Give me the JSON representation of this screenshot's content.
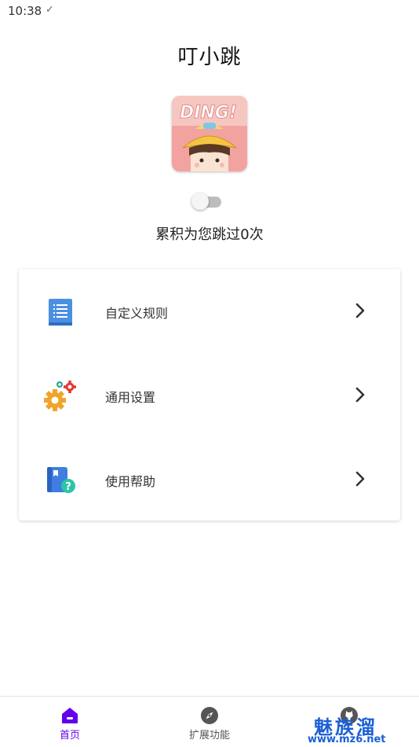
{
  "status_bar": {
    "time": "10:38",
    "check": "✓"
  },
  "app": {
    "title": "叮小跳",
    "icon_text": "DING!"
  },
  "toggle": {
    "on": false
  },
  "skip_count_text": "累积为您跳过0次",
  "menu": {
    "items": [
      {
        "label": "自定义规则",
        "icon": "rules-document-icon"
      },
      {
        "label": "通用设置",
        "icon": "gears-icon"
      },
      {
        "label": "使用帮助",
        "icon": "help-book-icon"
      }
    ]
  },
  "bottom_nav": {
    "items": [
      {
        "label": "首页",
        "icon": "home-icon",
        "active": true
      },
      {
        "label": "扩展功能",
        "icon": "compass-icon",
        "active": false
      },
      {
        "label": "",
        "icon": "github-icon",
        "active": false
      }
    ]
  },
  "watermark": {
    "chinese": "魅族溜",
    "url": "www.mz6.net"
  },
  "colors": {
    "accent": "#6200ee",
    "watermark": "#1a5fd6"
  }
}
